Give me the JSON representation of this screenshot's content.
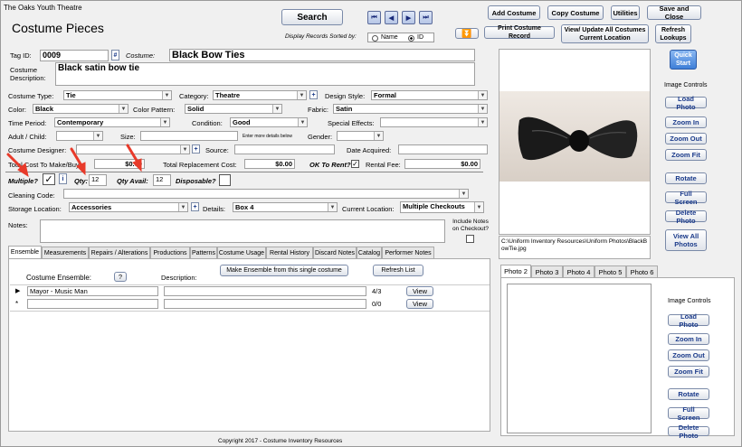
{
  "app": {
    "org_name": "The Oaks Youth Theatre",
    "form_title": "Costume Pieces",
    "copyright": "Copyright 2017  - Costume Inventory Resources"
  },
  "toolbar": {
    "search": "Search",
    "sort_label": "Display Records Sorted by:",
    "sort_name": "Name",
    "sort_id": "ID",
    "add_costume": "Add Costume",
    "copy_costume": "Copy Costume",
    "utilities": "Utilities",
    "save_close": "Save and Close",
    "print_record": "Print Costume Record",
    "view_update": "View/ Update All Costumes Current Location",
    "refresh_lookups": "Refresh Lookups",
    "quick_start": "Quick Start",
    "nav": [
      "first-record",
      "previous-record",
      "next-record",
      "last-record"
    ]
  },
  "fields": {
    "tag_id_label": "Tag ID:",
    "tag_id": "0009",
    "tag_hash": "#",
    "costume_label": "Costume:",
    "costume": "Black Bow Ties",
    "desc_label": "Costume Description:",
    "desc": "Black satin bow tie",
    "type_label": "Costume Type:",
    "type": "Tie",
    "category_label": "Category:",
    "category": "Theatre",
    "design_label": "Design Style:",
    "design": "Formal",
    "color_label": "Color:",
    "color": "Black",
    "pattern_label": "Color Pattern:",
    "pattern": "Solid",
    "fabric_label": "Fabric:",
    "fabric": "Satin",
    "period_label": "Time Period:",
    "period": "Contemporary",
    "condition_label": "Condition:",
    "condition": "Good",
    "effects_label": "Special Effects:",
    "effects": "",
    "adult_label": "Adult / Child:",
    "adult": "",
    "size_label": "Size:",
    "size": "",
    "more_details": "Enter more details below",
    "gender_label": "Gender:",
    "gender": "",
    "designer_label": "Costume Designer:",
    "designer": "",
    "source_label": "Source:",
    "source": "",
    "acquired_label": "Date Acquired:",
    "acquired": "",
    "total_cost_label": "Total Cost To Make/Buy:",
    "total_cost": "$0.00",
    "replacement_label": "Total Replacement Cost:",
    "replacement": "$0.00",
    "ok_rent_label": "OK To Rent?",
    "rental_fee_label": "Rental Fee:",
    "rental_fee": "$0.00",
    "multiple_label": "Multiple?",
    "multiple_check": "✓",
    "qty_label": "Qty:",
    "qty": "12",
    "qty_avail_label": "Qty Avail:",
    "qty_avail": "12",
    "disposable_label": "Disposable?",
    "cleaning_label": "Cleaning Code:",
    "cleaning": "",
    "storage_label": "Storage Location:",
    "storage": "Accessories",
    "details_label": "Details:",
    "details": "Box 4",
    "current_loc_label": "Current Location:",
    "current_loc": "Multiple Checkouts",
    "notes_label": "Notes:",
    "notes": "",
    "include_notes_label": "Include Notes on Checkout?"
  },
  "tabs": [
    {
      "label": "Ensemble"
    },
    {
      "label": "Measurements"
    },
    {
      "label": "Repairs / Alterations"
    },
    {
      "label": "Productions"
    },
    {
      "label": "Patterns"
    },
    {
      "label": "Costume Usage"
    },
    {
      "label": "Rental History"
    },
    {
      "label": "Discard Notes"
    },
    {
      "label": "Catalog"
    },
    {
      "label": "Performer Notes"
    }
  ],
  "ensemble": {
    "col_ensemble": "Costume Ensemble:",
    "help": "?",
    "col_desc": "Description:",
    "make_btn": "Make Ensemble from this single costume",
    "refresh_btn": "Refresh List",
    "rows": [
      {
        "marker": "▶",
        "name": "Mayor - Music Man",
        "desc": "",
        "count": "4/3",
        "view": "View"
      },
      {
        "marker": "*",
        "name": "",
        "desc": "",
        "count": "0/0",
        "view": "View"
      }
    ]
  },
  "image_panel": {
    "file_path": "C:\\Uniform Inventory Resources\\Uniform Photos\\BlackBowTie.jpg",
    "controls_label": "Image Controls",
    "load": "Load Photo",
    "zoom_in": "Zoom In",
    "zoom_out": "Zoom Out",
    "zoom_fit": "Zoom Fit",
    "rotate": "Rotate",
    "full_screen": "Full Screen",
    "delete": "Delete Photo",
    "view_all": "View All Photos"
  },
  "photo_tabs": [
    {
      "label": "Photo 2"
    },
    {
      "label": "Photo 3"
    },
    {
      "label": "Photo 4"
    },
    {
      "label": "Photo 5"
    },
    {
      "label": "Photo 6"
    }
  ],
  "photo2_panel": {
    "controls_label": "Image Controls",
    "load": "Load Photo",
    "zoom_in": "Zoom In",
    "zoom_out": "Zoom Out",
    "zoom_fit": "Zoom Fit",
    "rotate": "Rotate",
    "full_screen": "Full Screen",
    "delete": "Delete Photo"
  },
  "colors": {
    "accent": "#1a3a8a",
    "annotation_arrow": "#e83a2a"
  }
}
